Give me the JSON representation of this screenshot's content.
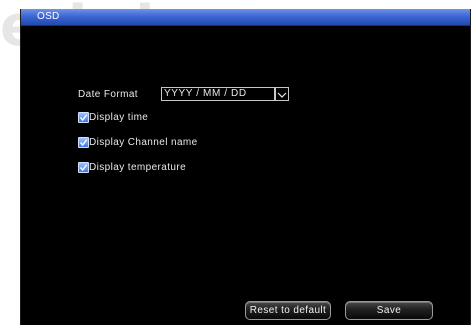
{
  "window": {
    "title": "OSD"
  },
  "date_format": {
    "label": "Date Format",
    "value": "YYYY / MM / DD"
  },
  "options": [
    {
      "label": "Display time",
      "checked": true
    },
    {
      "label": "Display Channel name",
      "checked": true
    },
    {
      "label": "Display temperature",
      "checked": true
    }
  ],
  "buttons": {
    "reset_label": "Reset to default",
    "save_label": "Save"
  },
  "icons": {
    "checkbox": "checkbox-checked-icon",
    "dropdown": "chevron-down-icon"
  },
  "colors": {
    "titlebar": "#3e67d4",
    "background": "#000000",
    "checkbox": "#3f78e8",
    "text": "#e8e8e8"
  }
}
